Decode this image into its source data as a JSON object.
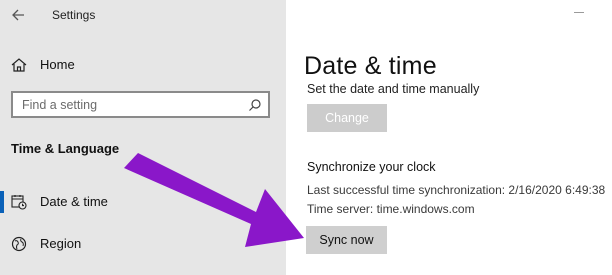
{
  "window": {
    "title": "Settings"
  },
  "sidebar": {
    "home_label": "Home",
    "search_placeholder": "Find a setting",
    "section_heading": "Time & Language",
    "items": [
      {
        "label": "Date & time",
        "icon": "calendar-clock-icon",
        "active": true
      },
      {
        "label": "Region",
        "icon": "globe-icon",
        "active": false
      }
    ]
  },
  "main": {
    "title": "Date & time",
    "manual_text": "Set the date and time manually",
    "change_button": "Change",
    "sync_heading": "Synchronize your clock",
    "last_sync": "Last successful time synchronization: 2/16/2020 6:49:38",
    "time_server": "Time server: time.windows.com",
    "sync_button": "Sync now"
  },
  "annotation": {
    "icon": "pointer-arrow",
    "color": "#8a17c9"
  },
  "colors": {
    "accent": "#0a61b8",
    "sidebar_bg": "#e6e6e6"
  }
}
